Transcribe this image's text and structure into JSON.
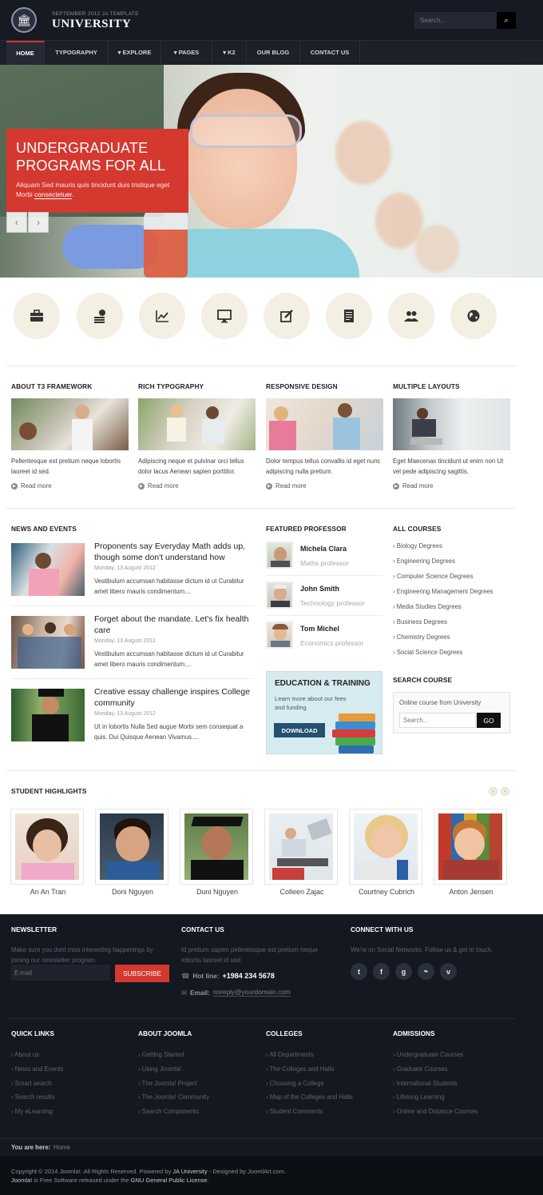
{
  "header": {
    "tagline": "SEPTEMBER 2012 JA TEMPLATE",
    "site_name": "UNIVERSITY",
    "search_placeholder": "Search..."
  },
  "nav": {
    "items": [
      {
        "label": "HOME"
      },
      {
        "label": "TYPOGRAPHY"
      },
      {
        "label": "▾ EXPLORE"
      },
      {
        "label": "▾ PAGES"
      },
      {
        "label": "▾ K2"
      },
      {
        "label": "OUR BLOG"
      },
      {
        "label": "CONTACT US"
      }
    ]
  },
  "hero": {
    "title": "UNDERGRADUATE PROGRAMS FOR ALL",
    "text": "Aliquam Sed mauris quis tincidunt duis tristique eget Morbi",
    "link": "consectetuer",
    "text_end": "."
  },
  "feature_icons": [
    "briefcase-icon",
    "money-icon",
    "chart-icon",
    "monitor-icon",
    "edit-icon",
    "document-icon",
    "users-icon",
    "globe-icon"
  ],
  "features": [
    {
      "title": "ABOUT T3 FRAMEWORK",
      "text": "Pellentesque est pretium neque lobortis laoreet id sed.",
      "link": "Read more"
    },
    {
      "title": "RICH TYPOGRAPHY",
      "text": "Adipiscing neque et pulvinar orci tellus dolor lacus Aenean sapien porttitor.",
      "link": "Read more"
    },
    {
      "title": "RESPONSIVE DESIGN",
      "text": "Dolor tempus tellus convallis id eget nunc adipiscing nulla pretium.",
      "link": "Read more"
    },
    {
      "title": "MULTIPLE LAYOUTS",
      "text": "Eget Maecenas tincidunt ut enim non Ut vel pede adipiscing sagittis.",
      "link": "Read more"
    }
  ],
  "news": {
    "heading": "NEWS AND EVENTS",
    "items": [
      {
        "title": "Proponents say Everyday Math adds up, though some don't understand how",
        "date": "Monday, 13 August 2012",
        "text": "Vestibulum accumsan habitasse dictum id ut Curabitur amet libero mauris condimentum...."
      },
      {
        "title": "Forget about the mandate. Let's fix health care",
        "date": "Monday, 13 August 2012",
        "text": "Vestibulum accumsan habitasse dictum id ut Curabitur amet libero mauris condimentum...."
      },
      {
        "title": "Creative essay challenge inspires College community",
        "date": "Monday, 13 August 2012",
        "text": "Ut in lobortis Nulla Sed augue Morbi sem consequat a quis. Dui Quisque Aenean Vivamus...."
      }
    ]
  },
  "professors": {
    "heading": "FEATURED PROFESSOR",
    "items": [
      {
        "name": "Michela Clara",
        "role": "Maths professor"
      },
      {
        "name": "John Smith",
        "role": "Technology professor"
      },
      {
        "name": "Tom Michel",
        "role": "Economics professor"
      }
    ]
  },
  "education": {
    "title": "EDUCATION & TRAINING",
    "text": "Learn more about our fees and funding",
    "button": "DOWNLOAD"
  },
  "courses": {
    "heading": "ALL COURSES",
    "items": [
      "Biology Degrees",
      "Engineering Degrees",
      "Computer Science Degrees",
      "Engineering Management Degrees",
      "Media Studies Degrees",
      "Business Degrees",
      "Chemistry Degrees",
      "Social Science Degrees"
    ]
  },
  "search_course": {
    "heading": "SEARCH COURSE",
    "label": "Online course from University",
    "placeholder": "Search...",
    "button": "GO"
  },
  "students": {
    "heading": "STUDENT HIGHLIGHTS",
    "items": [
      {
        "name": "An An Tran"
      },
      {
        "name": "Doni Nguyen"
      },
      {
        "name": "Duni Nguyen"
      },
      {
        "name": "Colleen Zajac"
      },
      {
        "name": "Courtney Cubrich"
      },
      {
        "name": "Anton Jensen"
      }
    ]
  },
  "footer": {
    "newsletter": {
      "heading": "NEWSLETTER",
      "text": "Make sure you dont miss interesting happenings by joining our newsletter program.",
      "placeholder": "E-mail",
      "button": "SUBSCRIBE"
    },
    "contact": {
      "heading": "CONTACT US",
      "text": "Id pretium sapien pellentesque est pretium neque lobortis laoreet id sed.",
      "hotline_label": "Hot line:",
      "hotline": "+1984 234 5678",
      "email_label": "Email:",
      "email": "noreply@yourdomain.com"
    },
    "connect": {
      "heading": "CONNECT WITH US",
      "text": "We're on Social Networks. Follow us & get in touch.",
      "icons": [
        "twitter-icon",
        "facebook-icon",
        "google-icon",
        "rss-icon",
        "vimeo-icon"
      ]
    },
    "columns": [
      {
        "heading": "QUICK LINKS",
        "links": [
          "About us",
          "News and Events",
          "Smart search",
          "Search results",
          "My eLearning"
        ]
      },
      {
        "heading": "ABOUT JOOMLA",
        "links": [
          "Getting Started",
          "Using Joomla!",
          "The Joomla! Project",
          "The Joomla! Community",
          "Search Components"
        ]
      },
      {
        "heading": "COLLEGES",
        "links": [
          "All Departments",
          "The Colleges and Halls",
          "Choosing a College",
          "Map of the Colleges and Halls",
          "Student Comments"
        ]
      },
      {
        "heading": "ADMISSIONS",
        "links": [
          "Undergraduate Courses",
          "Graduate Courses",
          "International Students",
          "Lifelong Learning",
          "Online and Distance Courses"
        ]
      }
    ],
    "breadcrumb_label": "You are here:",
    "breadcrumb_home": "Home",
    "copyright_1a": "Copyright © 2014 Joomla!. All Rights Reserved. Powered by ",
    "copyright_1b": "JA University",
    "copyright_1c": " - Designed by JoomlArt.com.",
    "copyright_2a": "Joomla!",
    "copyright_2b": " is Free Software released under the ",
    "copyright_2c": "GNU General Public License."
  }
}
